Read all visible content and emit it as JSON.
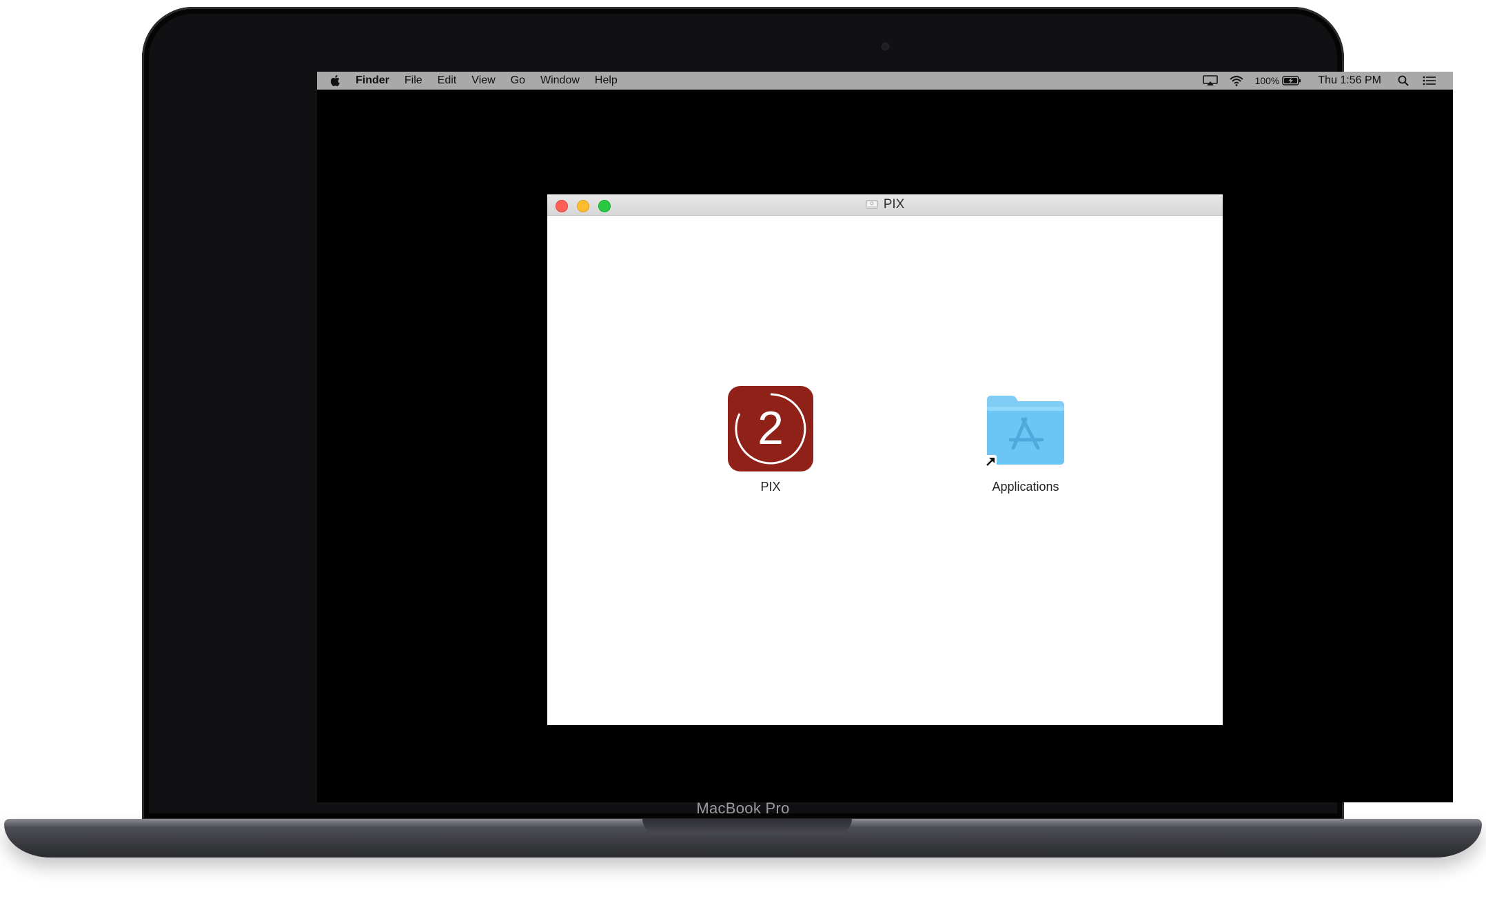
{
  "device": {
    "brand_label": "MacBook Pro"
  },
  "menubar": {
    "apple_icon": "apple-logo-icon",
    "app_name": "Finder",
    "items": [
      "File",
      "Edit",
      "View",
      "Go",
      "Window",
      "Help"
    ],
    "status": {
      "airplay_icon": "airplay-icon",
      "wifi_icon": "wifi-icon",
      "battery_percent": "100%",
      "battery_icon": "battery-charging-icon",
      "clock": "Thu 1:56 PM",
      "search_icon": "spotlight-search-icon",
      "notification_icon": "notification-center-icon"
    }
  },
  "window": {
    "title": "PIX",
    "title_icon": "disk-image-icon",
    "items": [
      {
        "label": "PIX",
        "icon": "pix-app-icon",
        "icon_text": "2",
        "color": "#8f2119"
      },
      {
        "label": "Applications",
        "icon": "applications-folder-alias-icon",
        "color": "#6cc5f4"
      }
    ]
  },
  "colors": {
    "menubar_bg": "#a9a9a9",
    "close": "#fe5f57",
    "minimize": "#febc2e",
    "zoom": "#28c840"
  }
}
